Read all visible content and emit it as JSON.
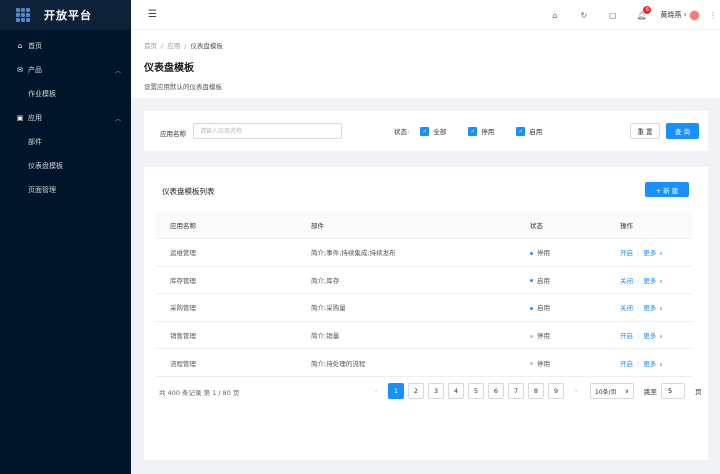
{
  "app": {
    "title": "开放平台"
  },
  "sidebar": {
    "items": [
      {
        "label": "首页",
        "icon": "home-icon"
      },
      {
        "label": "产品",
        "icon": "mail-icon",
        "children": [
          {
            "label": "作业模板"
          }
        ]
      },
      {
        "label": "应用",
        "icon": "app-icon",
        "children": [
          {
            "label": "部件"
          },
          {
            "label": "仪表盘模板"
          },
          {
            "label": "页面管理"
          }
        ]
      }
    ]
  },
  "header": {
    "notification_count": "6",
    "user_name": "黄晓燕",
    "icons": [
      "home-icon",
      "refresh-icon",
      "fullscreen-icon",
      "bell-icon"
    ]
  },
  "breadcrumb": [
    "首页",
    "应用",
    "仪表盘模板"
  ],
  "page": {
    "title": "仪表盘模板",
    "description": "设置应用默认的仪表盘模板"
  },
  "filter": {
    "name_label": "应用名称",
    "name_placeholder": "请输入应用名称",
    "status_label": "状态:",
    "options": [
      "全部",
      "停用",
      "启用"
    ],
    "reset_label": "重 置",
    "query_label": "查 询"
  },
  "list": {
    "title": "仪表盘模板列表",
    "new_label": "+ 新 建",
    "columns": [
      "应用名称",
      "部件",
      "状态",
      "操作"
    ],
    "rows": [
      {
        "name": "运维管理",
        "parts": "简介;事件;持续集成;持续发布",
        "status": "停用",
        "status_color": "#1890ff",
        "action": "开启",
        "more": "更多"
      },
      {
        "name": "库存管理",
        "parts": "简介;库存",
        "status": "启用",
        "status_color": "#1890ff",
        "action": "关闭",
        "more": "更多"
      },
      {
        "name": "采购管理",
        "parts": "简介;采购量",
        "status": "启用",
        "status_color": "#1890ff",
        "action": "关闭",
        "more": "更多"
      },
      {
        "name": "销售管理",
        "parts": "简介;销量",
        "status": "停用",
        "status_color": "#bfbfbf",
        "action": "开启",
        "more": "更多"
      },
      {
        "name": "流程管理",
        "parts": "简介;待处理的流程",
        "status": "停用",
        "status_color": "#bfbfbf",
        "action": "开启",
        "more": "更多"
      }
    ]
  },
  "pagination": {
    "total_text": "共 400 条记录 第 1 / 80 页",
    "pages": [
      "1",
      "2",
      "3",
      "4",
      "5",
      "6",
      "7",
      "8",
      "9"
    ],
    "current": "1",
    "page_size": "10条/页",
    "jump_label": "跳至",
    "jump_value": "5",
    "page_unit": "页"
  }
}
